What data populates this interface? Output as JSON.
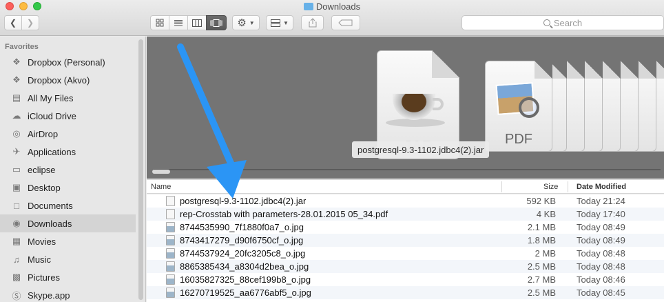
{
  "window": {
    "title": "Downloads"
  },
  "toolbar": {
    "back_icon": "chevron-left-icon",
    "forward_icon": "chevron-right-icon",
    "view_modes": [
      "icon-view",
      "list-view",
      "column-view",
      "cover-flow-view"
    ],
    "active_view": "cover-flow-view",
    "search_placeholder": "Search"
  },
  "sidebar": {
    "heading": "Favorites",
    "items": [
      {
        "label": "Dropbox (Personal)",
        "icon": "dropbox-icon"
      },
      {
        "label": "Dropbox (Akvo)",
        "icon": "dropbox-icon"
      },
      {
        "label": "All My Files",
        "icon": "all-files-icon"
      },
      {
        "label": "iCloud Drive",
        "icon": "cloud-icon"
      },
      {
        "label": "AirDrop",
        "icon": "airdrop-icon"
      },
      {
        "label": "Applications",
        "icon": "applications-icon"
      },
      {
        "label": "eclipse",
        "icon": "folder-icon"
      },
      {
        "label": "Desktop",
        "icon": "desktop-icon"
      },
      {
        "label": "Documents",
        "icon": "documents-icon"
      },
      {
        "label": "Downloads",
        "icon": "downloads-icon",
        "active": true
      },
      {
        "label": "Movies",
        "icon": "movies-icon"
      },
      {
        "label": "Music",
        "icon": "music-icon"
      },
      {
        "label": "Pictures",
        "icon": "pictures-icon"
      },
      {
        "label": "Skype.app",
        "icon": "skype-icon"
      }
    ]
  },
  "coverflow": {
    "caption": "postgresql-9.3-1102.jdbc4(2).jar",
    "jar_label": "JAR",
    "pdf_label": "PDF"
  },
  "columns": {
    "name": "Name",
    "size": "Size",
    "date": "Date Modified"
  },
  "files": [
    {
      "name": "postgresql-9.3-1102.jdbc4(2).jar",
      "size": "592 KB",
      "date": "Today 21:24",
      "kind": "jar"
    },
    {
      "name": "rep-Crosstab with parameters-28.01.2015 05_34.pdf",
      "size": "4 KB",
      "date": "Today 17:40",
      "kind": "pdf"
    },
    {
      "name": "8744535990_7f1880f0a7_o.jpg",
      "size": "2.1 MB",
      "date": "Today 08:49",
      "kind": "img"
    },
    {
      "name": "8743417279_d90f6750cf_o.jpg",
      "size": "1.8 MB",
      "date": "Today 08:49",
      "kind": "img"
    },
    {
      "name": "8744537924_20fc3205c8_o.jpg",
      "size": "2 MB",
      "date": "Today 08:48",
      "kind": "img"
    },
    {
      "name": "8865385434_a8304d2bea_o.jpg",
      "size": "2.5 MB",
      "date": "Today 08:48",
      "kind": "img"
    },
    {
      "name": "16035827325_88cef199b8_o.jpg",
      "size": "2.7 MB",
      "date": "Today 08:46",
      "kind": "img"
    },
    {
      "name": "16270719525_aa6776abf5_o.jpg",
      "size": "2.5 MB",
      "date": "Today 08:45",
      "kind": "img"
    }
  ],
  "annotation": {
    "color": "#2b95f5",
    "icon": "blue-arrow-annotation"
  }
}
